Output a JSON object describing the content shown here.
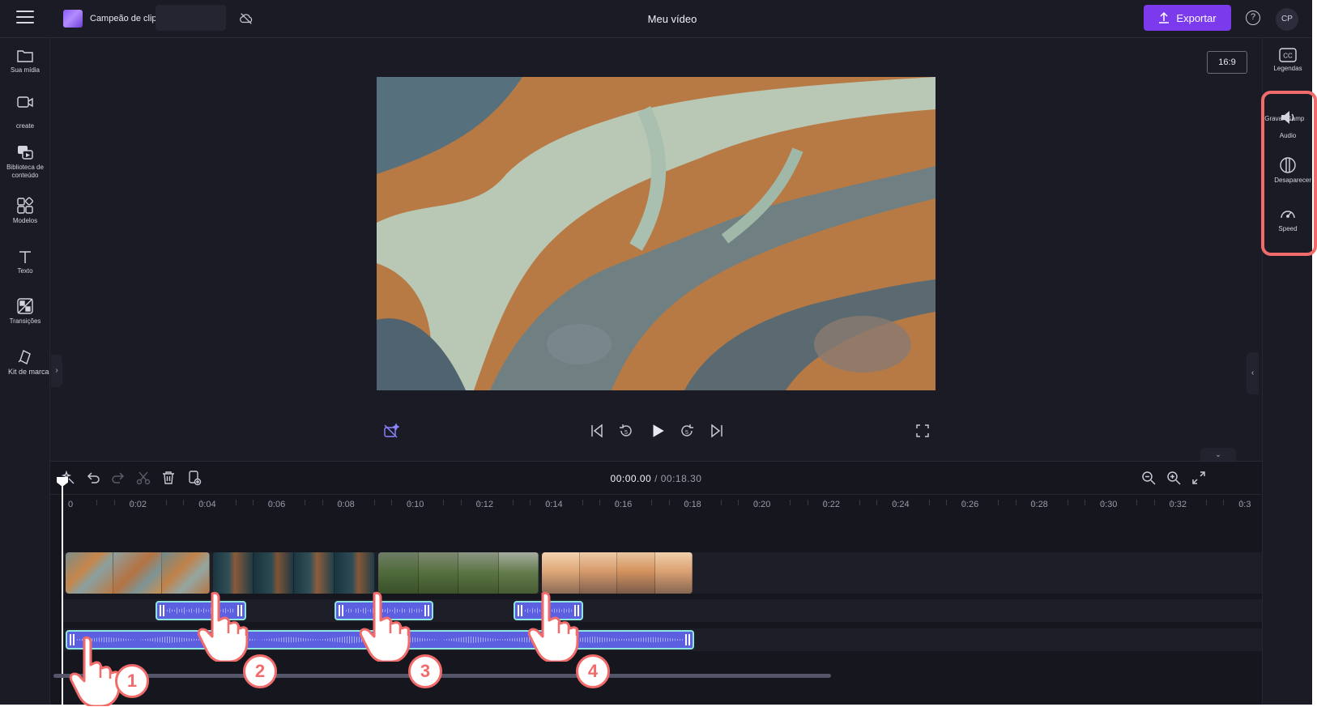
{
  "topbar": {
    "project_name": "Campeão de clipes",
    "video_title": "Meu vídeo",
    "export_label": "Exportar",
    "help_icon": "?",
    "avatar_initials": "CP"
  },
  "left_nav": [
    {
      "label": "Sua mídia",
      "icon": "folder-icon"
    },
    {
      "label": "create",
      "icon": "video-camera-icon"
    },
    {
      "label": "Biblioteca de conteúdo",
      "icon": "content-library-icon"
    },
    {
      "label": "Modelos",
      "icon": "templates-icon"
    },
    {
      "label": "Texto",
      "icon": "text-icon"
    },
    {
      "label": "Transições",
      "icon": "transitions-icon"
    },
    {
      "label": "Kit de marca",
      "icon": "brand-kit-icon"
    }
  ],
  "right_nav": [
    {
      "label": "Legendas",
      "icon": "captions-icon"
    },
    {
      "label": "Audio",
      "icon": "speaker-icon",
      "overlay": ";Gravar' &amp"
    },
    {
      "label": "Desaparecer",
      "icon": "fade-icon"
    },
    {
      "label": "Speed",
      "icon": "speedometer-icon"
    }
  ],
  "preview": {
    "aspect_ratio": "16:9"
  },
  "timeline": {
    "current_time": "00:00.00",
    "total_time": "/ 00:18.30",
    "ticks": [
      "0",
      "0:02",
      "0:04",
      "0:06",
      "0:08",
      "0:10",
      "0:12",
      "0:14",
      "0:16",
      "0:18",
      "0:20",
      "0:22",
      "0:24",
      "0:26",
      "0:28",
      "0:30",
      "0:32",
      "0:3"
    ]
  },
  "annotations": [
    "1",
    "2",
    "3",
    "4"
  ],
  "colors": {
    "accent": "#7c3aed",
    "highlight": "#f26b6b",
    "audio_clip": "#5b5fe0",
    "audio_border": "#8ee6e0"
  }
}
